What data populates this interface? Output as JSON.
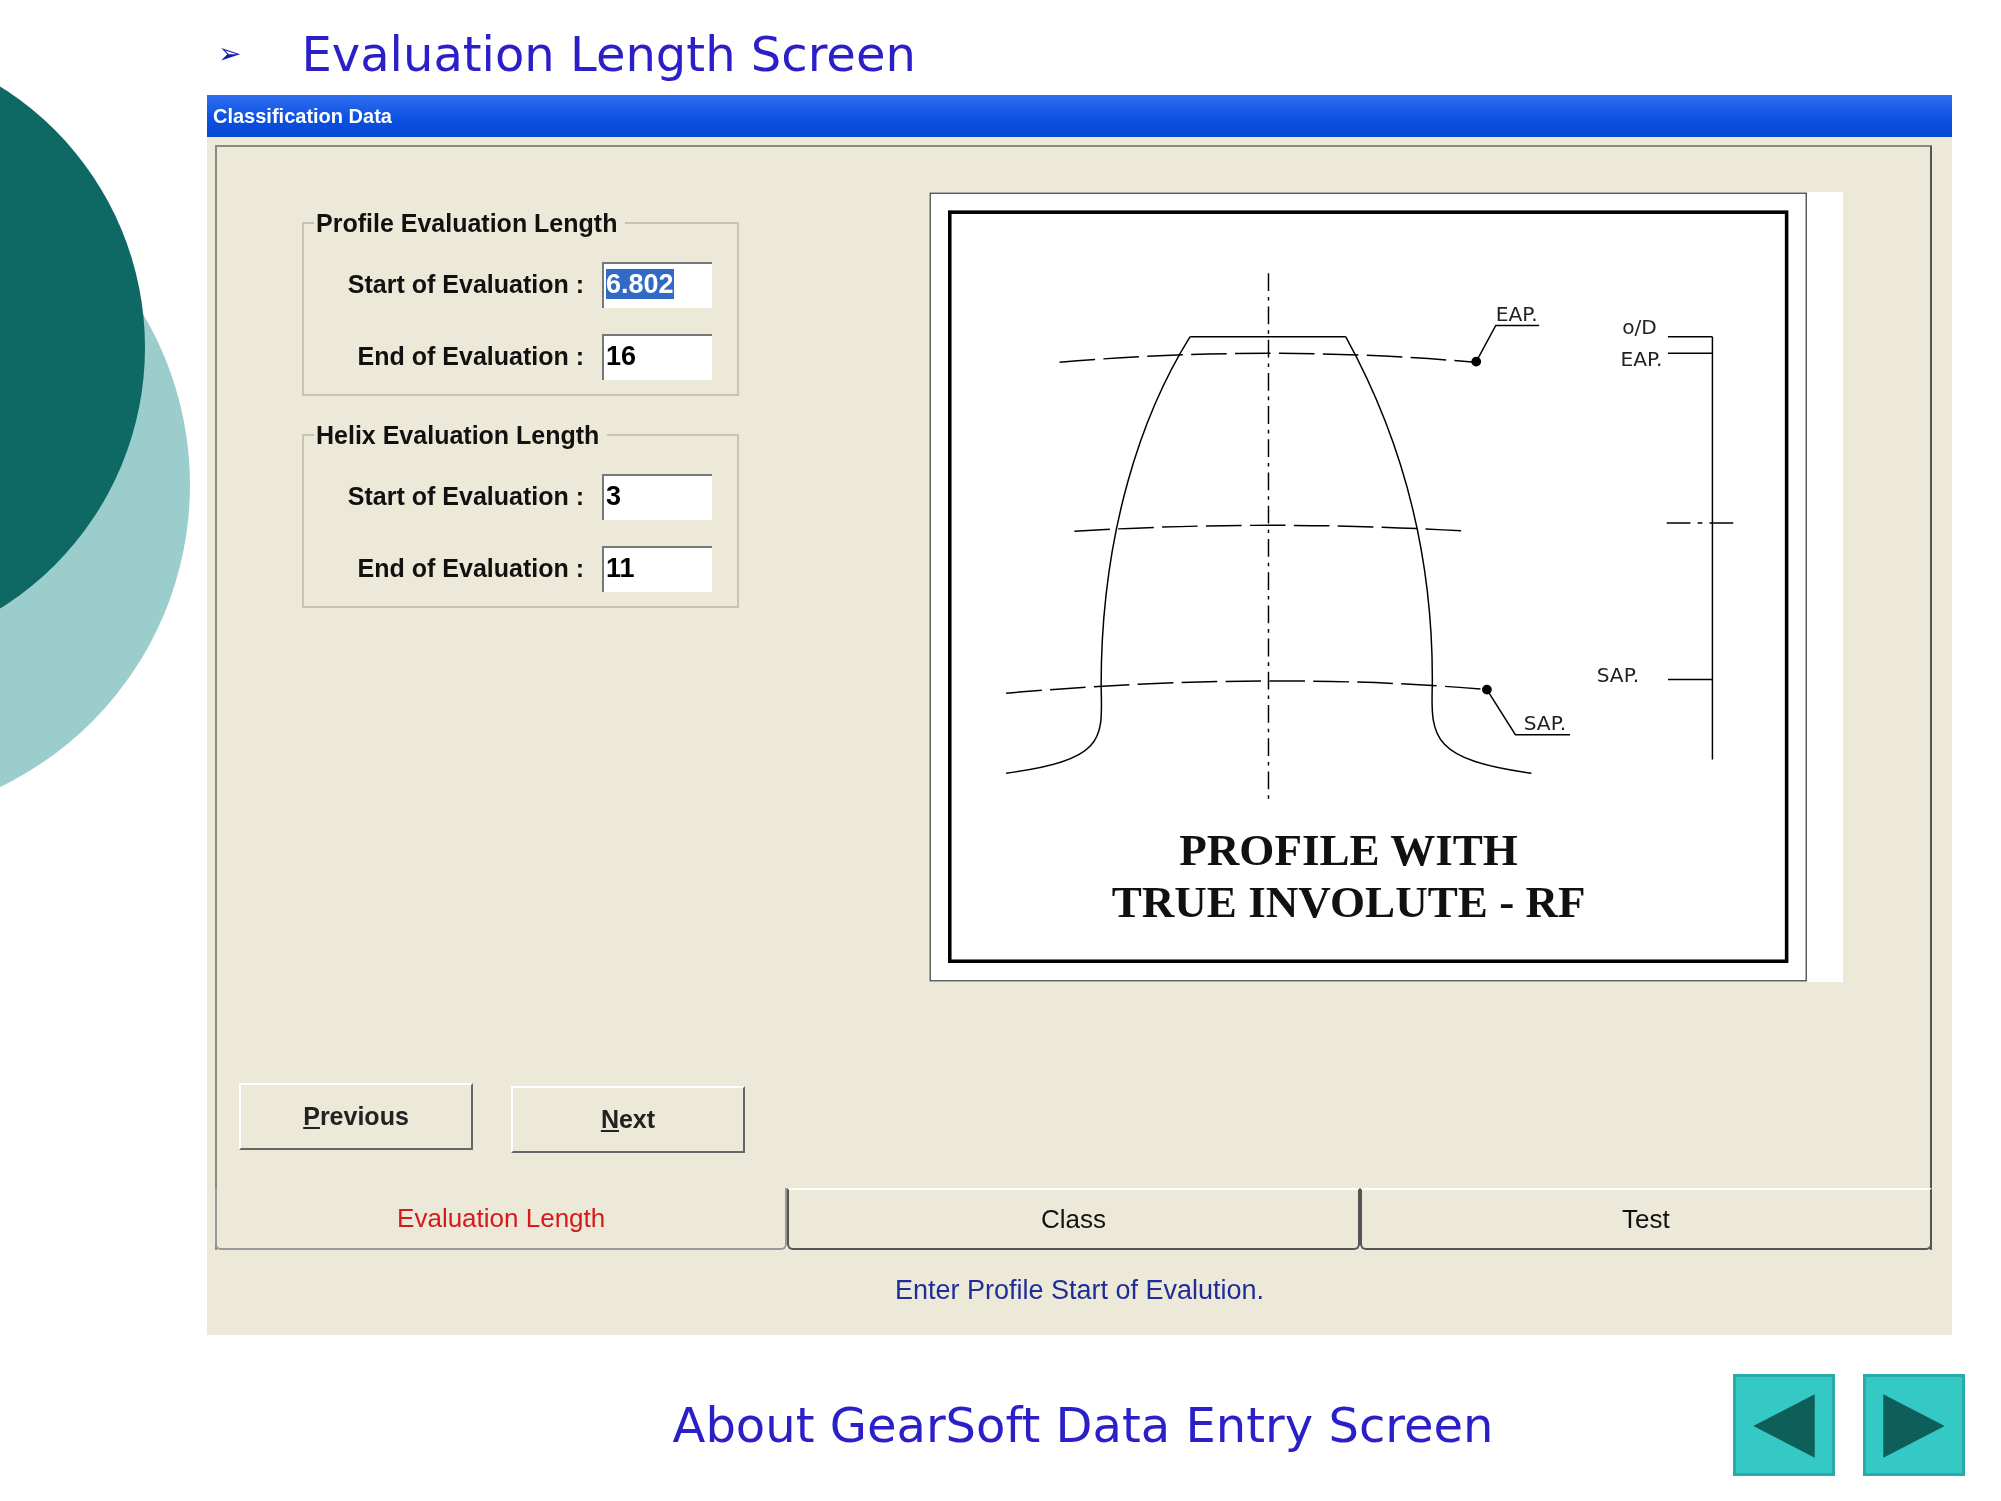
{
  "slide": {
    "bullet": "➢",
    "heading": "Evaluation Length Screen",
    "footer": "About GearSoft Data Entry Screen",
    "nav_buttons": [
      {
        "kind": "previous"
      },
      {
        "kind": "next"
      }
    ]
  },
  "window": {
    "title": "Classification Data",
    "groups": [
      {
        "title": "Profile Evaluation Length",
        "fields": [
          {
            "label": "Start of Evaluation :",
            "value": "6.802",
            "selected": true
          },
          {
            "label": "End of Evaluation :",
            "value": "16",
            "selected": false
          }
        ]
      },
      {
        "title": "Helix Evaluation Length",
        "fields": [
          {
            "label": "Start of Evaluation :",
            "value": "3",
            "selected": false
          },
          {
            "label": "End of Evaluation :",
            "value": "11",
            "selected": false
          }
        ]
      }
    ],
    "figure": {
      "labels": [
        {
          "kind": "eap_leader",
          "text": "EAP."
        },
        {
          "kind": "od",
          "text": "o/D"
        },
        {
          "kind": "eap_side",
          "text": "EAP."
        },
        {
          "kind": "sap_side",
          "text": "SAP."
        },
        {
          "kind": "sap_leader",
          "text": "SAP."
        }
      ],
      "caption": [
        "PROFILE WITH",
        "TRUE INVOLUTE - RF"
      ]
    },
    "buttons": [
      {
        "label": "Previous",
        "mnemonic": true
      },
      {
        "label": "Next",
        "mnemonic": true
      }
    ],
    "tabs": [
      {
        "label": "Evaluation Length",
        "selected": true
      },
      {
        "label": "Class",
        "selected": false
      },
      {
        "label": "Test",
        "selected": false
      }
    ],
    "status": "Enter Profile Start of Evalution."
  }
}
